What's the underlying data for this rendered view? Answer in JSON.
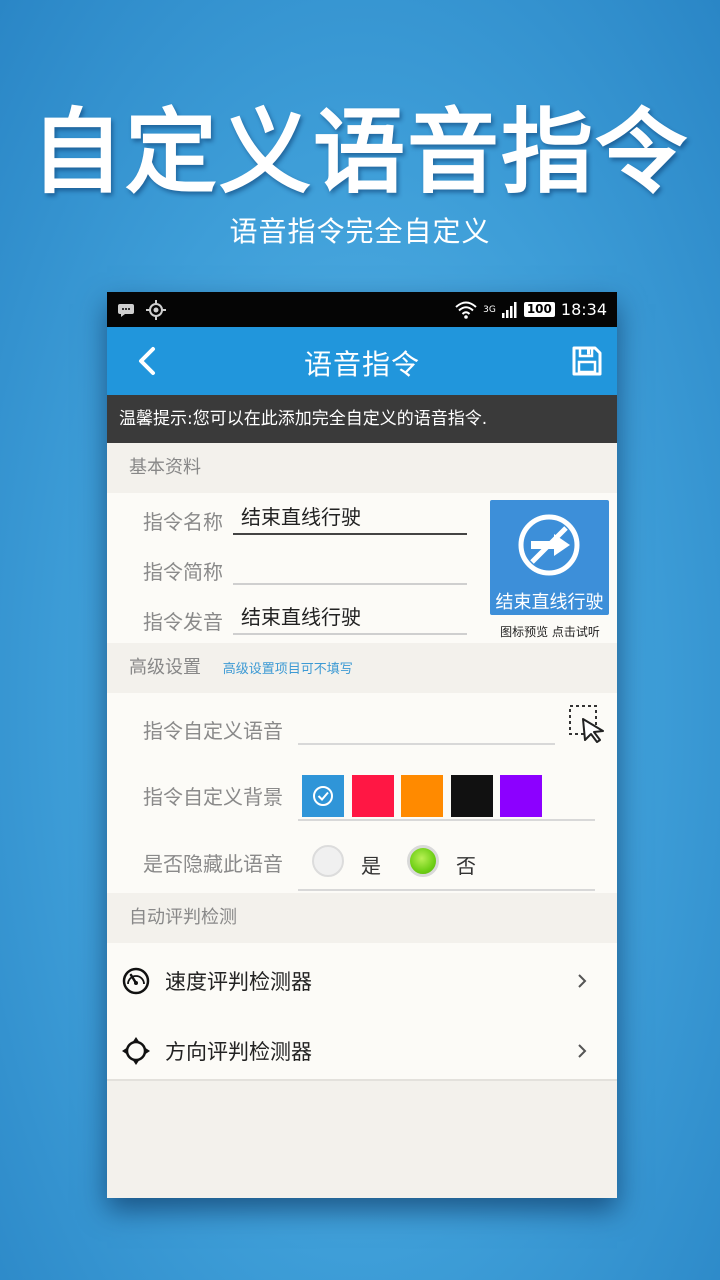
{
  "promo": {
    "title": "自定义语音指令",
    "subtitle": "语音指令完全自定义"
  },
  "status_bar": {
    "network": "3G",
    "battery": "100",
    "time": "18:34"
  },
  "app_bar": {
    "title": "语音指令"
  },
  "tip": "温馨提示:您可以在此添加完全自定义的语音指令.",
  "basic": {
    "header": "基本资料",
    "fields": [
      {
        "label": "指令名称",
        "value": "结束直线行驶"
      },
      {
        "label": "指令简称",
        "value": ""
      },
      {
        "label": "指令发音",
        "value": "结束直线行驶"
      }
    ],
    "preview_caption": "结束直线行驶",
    "preview_note": "图标预览 点击试听"
  },
  "advanced": {
    "header": "高级设置",
    "hint": "高级设置项目可不填写",
    "custom_voice_label": "指令自定义语音",
    "custom_voice_value": "",
    "background_label": "指令自定义背景",
    "colors": [
      "#2f95d8",
      "#ff1744",
      "#ff8a00",
      "#111111",
      "#8c00ff"
    ],
    "selected_color_index": 0,
    "hide_label": "是否隐藏此语音",
    "hide_options": [
      "是",
      "否"
    ],
    "hide_selected": "否"
  },
  "auto": {
    "header": "自动评判检测",
    "items": [
      {
        "label": "速度评判检测器",
        "icon": "speedometer-icon"
      },
      {
        "label": "方向评判检测器",
        "icon": "direction-icon"
      }
    ]
  }
}
